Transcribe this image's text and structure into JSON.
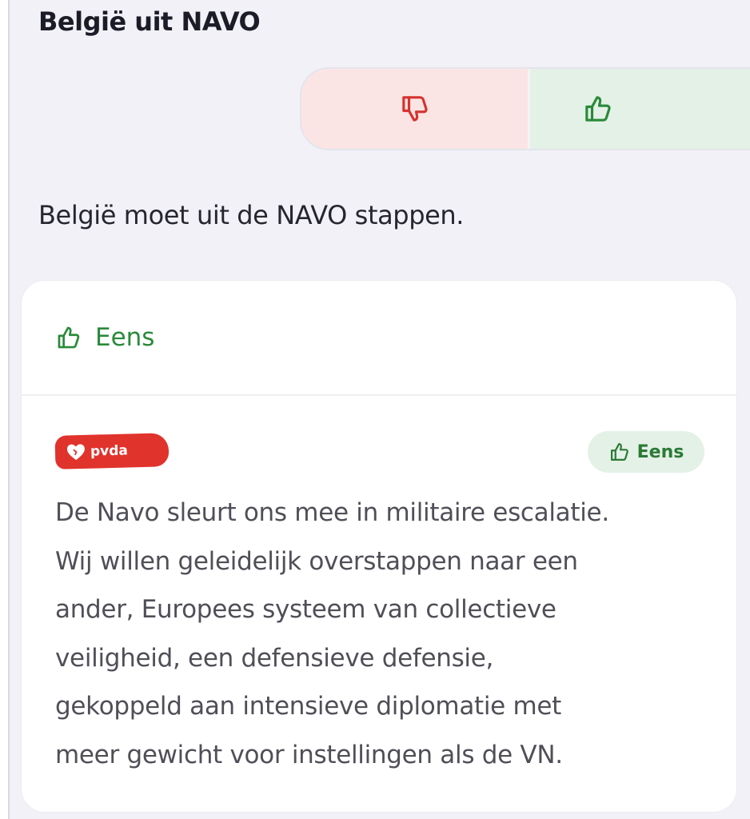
{
  "topic": {
    "title": "België uit NAVO"
  },
  "vote": {
    "disagree_icon": "thumbs-down-icon",
    "agree_icon": "thumbs-up-icon",
    "colors": {
      "disagree_bg": "#fbe5e4",
      "disagree_fg": "#d5332f",
      "agree_bg": "#e4f1e6",
      "agree_fg": "#2a8a3a"
    }
  },
  "statement": "België moet uit de NAVO stappen.",
  "opinion_card": {
    "header_label": "Eens",
    "header_icon": "thumbs-up-icon",
    "party": {
      "name": "pvda",
      "logo_icon": "heart-logo-icon",
      "brand_color": "#e0332c",
      "stance": "Eens",
      "stance_icon": "thumbs-up-icon",
      "text_lines": [
        "De Navo sleurt ons mee in militaire escalatie.",
        "Wij willen geleidelijk overstappen naar een",
        "ander, Europees systeem van collectieve",
        "veiligheid, een defensieve defensie,",
        "gekoppeld aan intensieve diplomatie met",
        "meer gewicht voor instellingen als de VN."
      ]
    }
  }
}
